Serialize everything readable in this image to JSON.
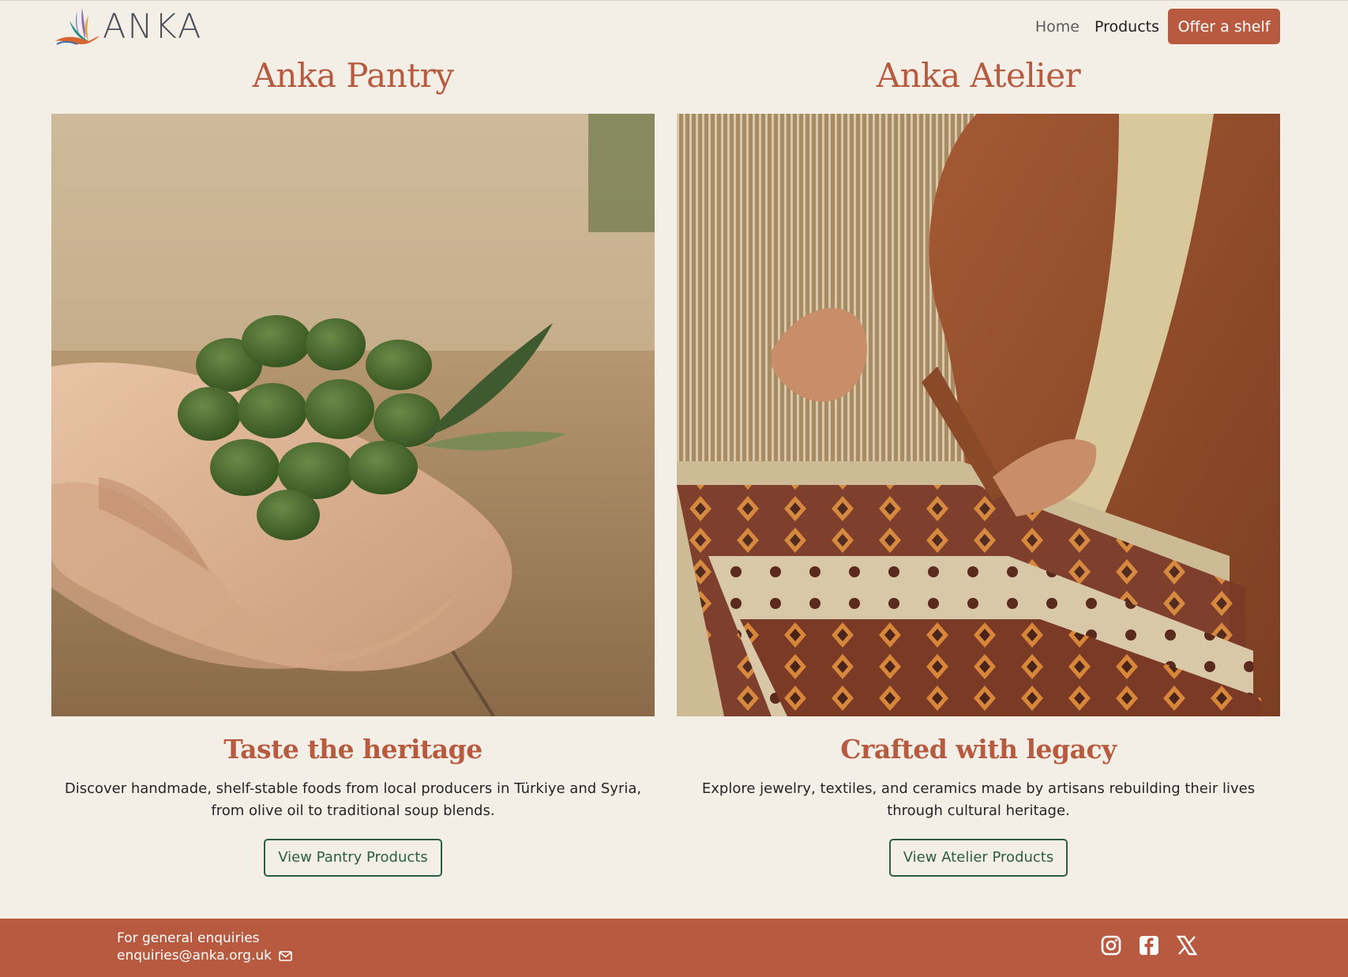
{
  "header": {
    "logo_text": "ANKA",
    "nav": {
      "home": "Home",
      "products": "Products"
    },
    "cta_label": "Offer a shelf"
  },
  "pantry": {
    "title": "Anka Pantry",
    "subtitle": "Taste the heritage",
    "description": "Discover handmade, shelf-stable foods from local producers in Türkiye and Syria, from olive oil to traditional soup blends.",
    "button_label": "View Pantry Products"
  },
  "atelier": {
    "title": "Anka Atelier",
    "subtitle": "Crafted with legacy",
    "description": "Explore jewelry, textiles, and ceramics made by artisans rebuilding their lives through cultural heritage.",
    "button_label": "View Atelier Products"
  },
  "footer": {
    "enquiries_label": "For general enquiries",
    "email": "enquiries@anka.org.uk",
    "social_icons": [
      "instagram-icon",
      "facebook-icon",
      "x-icon"
    ]
  },
  "colors": {
    "background": "#f4efe6",
    "accent": "#b85a40",
    "button_outline": "#2c5e45"
  }
}
